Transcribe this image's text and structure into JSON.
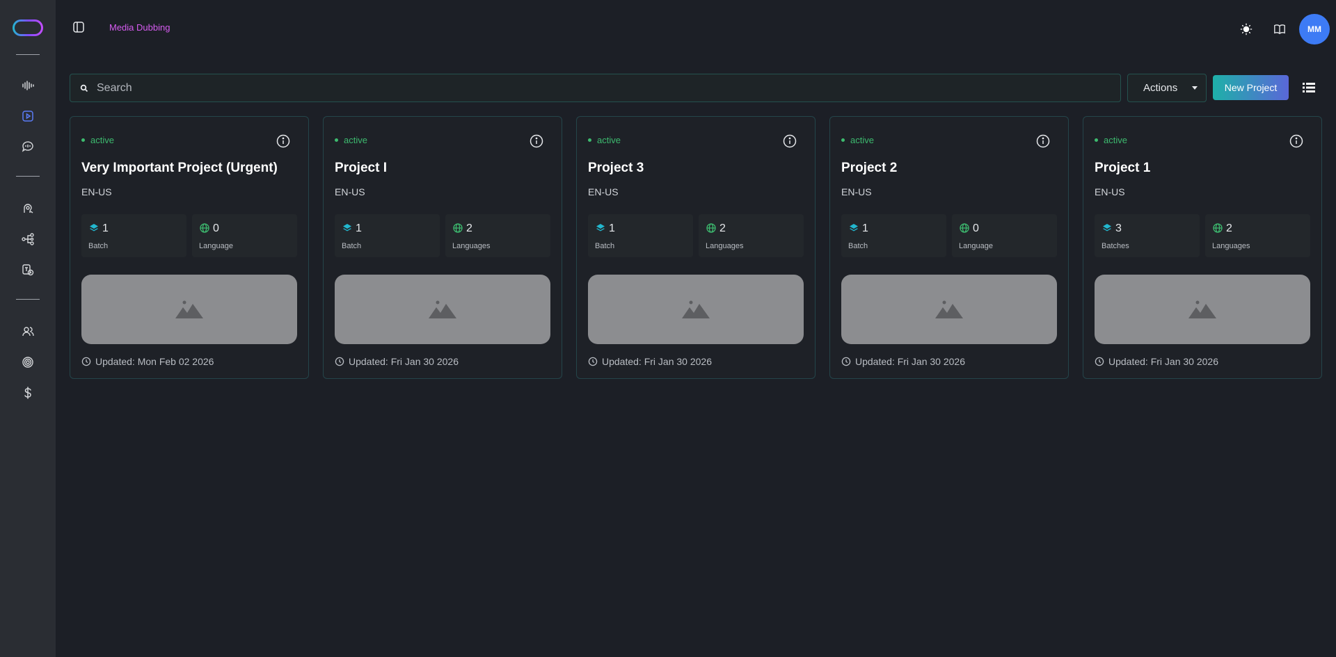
{
  "header": {
    "title": "Media Dubbing",
    "avatar_initials": "MM"
  },
  "toolbar": {
    "search_placeholder": "Search",
    "actions_label": "Actions",
    "new_project_label": "New Project"
  },
  "sidebar": {
    "icons": [
      "waveform-icon",
      "video-icon",
      "speech-bubble-icon",
      "voice-profile-icon",
      "workflow-icon",
      "translate-file-icon",
      "users-icon",
      "fingerprint-icon",
      "dollar-icon"
    ],
    "active": "video-icon"
  },
  "colors": {
    "accent_title": "#d65cf0",
    "status_active": "#3dba6f",
    "avatar_bg": "#3d7bf5"
  },
  "projects": [
    {
      "status": "active",
      "title": "Very Important Project (Urgent)",
      "language": "EN-US",
      "batch_count": "1",
      "batch_label": "Batch",
      "lang_count": "0",
      "lang_label": "Language",
      "updated": "Updated: Mon Feb 02 2026"
    },
    {
      "status": "active",
      "title": "Project I",
      "language": "EN-US",
      "batch_count": "1",
      "batch_label": "Batch",
      "lang_count": "2",
      "lang_label": "Languages",
      "updated": "Updated: Fri Jan 30 2026"
    },
    {
      "status": "active",
      "title": "Project 3",
      "language": "EN-US",
      "batch_count": "1",
      "batch_label": "Batch",
      "lang_count": "2",
      "lang_label": "Languages",
      "updated": "Updated: Fri Jan 30 2026"
    },
    {
      "status": "active",
      "title": "Project 2",
      "language": "EN-US",
      "batch_count": "1",
      "batch_label": "Batch",
      "lang_count": "0",
      "lang_label": "Language",
      "updated": "Updated: Fri Jan 30 2026"
    },
    {
      "status": "active",
      "title": "Project 1",
      "language": "EN-US",
      "batch_count": "3",
      "batch_label": "Batches",
      "lang_count": "2",
      "lang_label": "Languages",
      "updated": "Updated: Fri Jan 30 2026"
    }
  ]
}
